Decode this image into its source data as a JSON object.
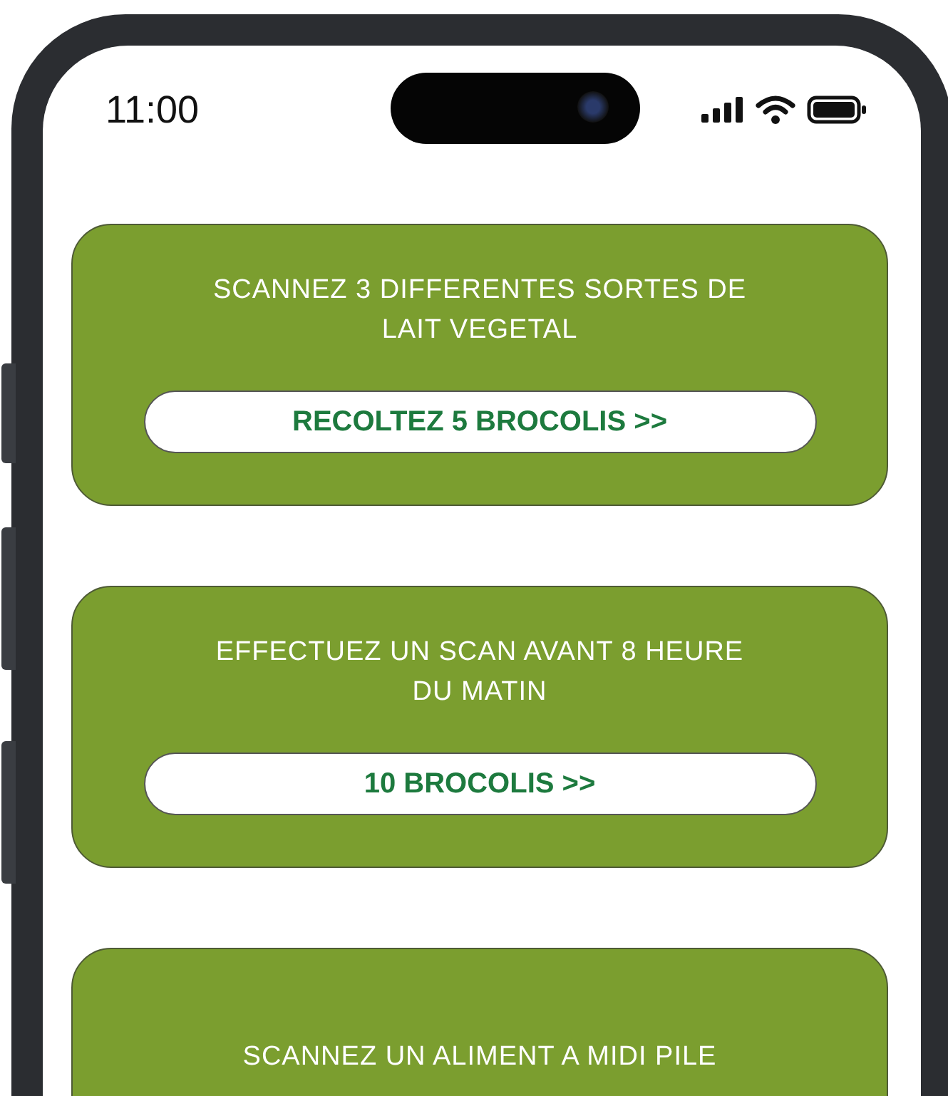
{
  "status_bar": {
    "time": "11:00"
  },
  "challenges": [
    {
      "title": "SCANNEZ 3 DIFFERENTES SORTES DE LAIT VEGETAL",
      "reward": "RECOLTEZ 5 BROCOLIS >>"
    },
    {
      "title": "EFFECTUEZ UN SCAN AVANT 8 HEURE DU MATIN",
      "reward": "10 BROCOLIS >>"
    },
    {
      "title": "SCANNEZ UN ALIMENT A MIDI PILE"
    }
  ]
}
